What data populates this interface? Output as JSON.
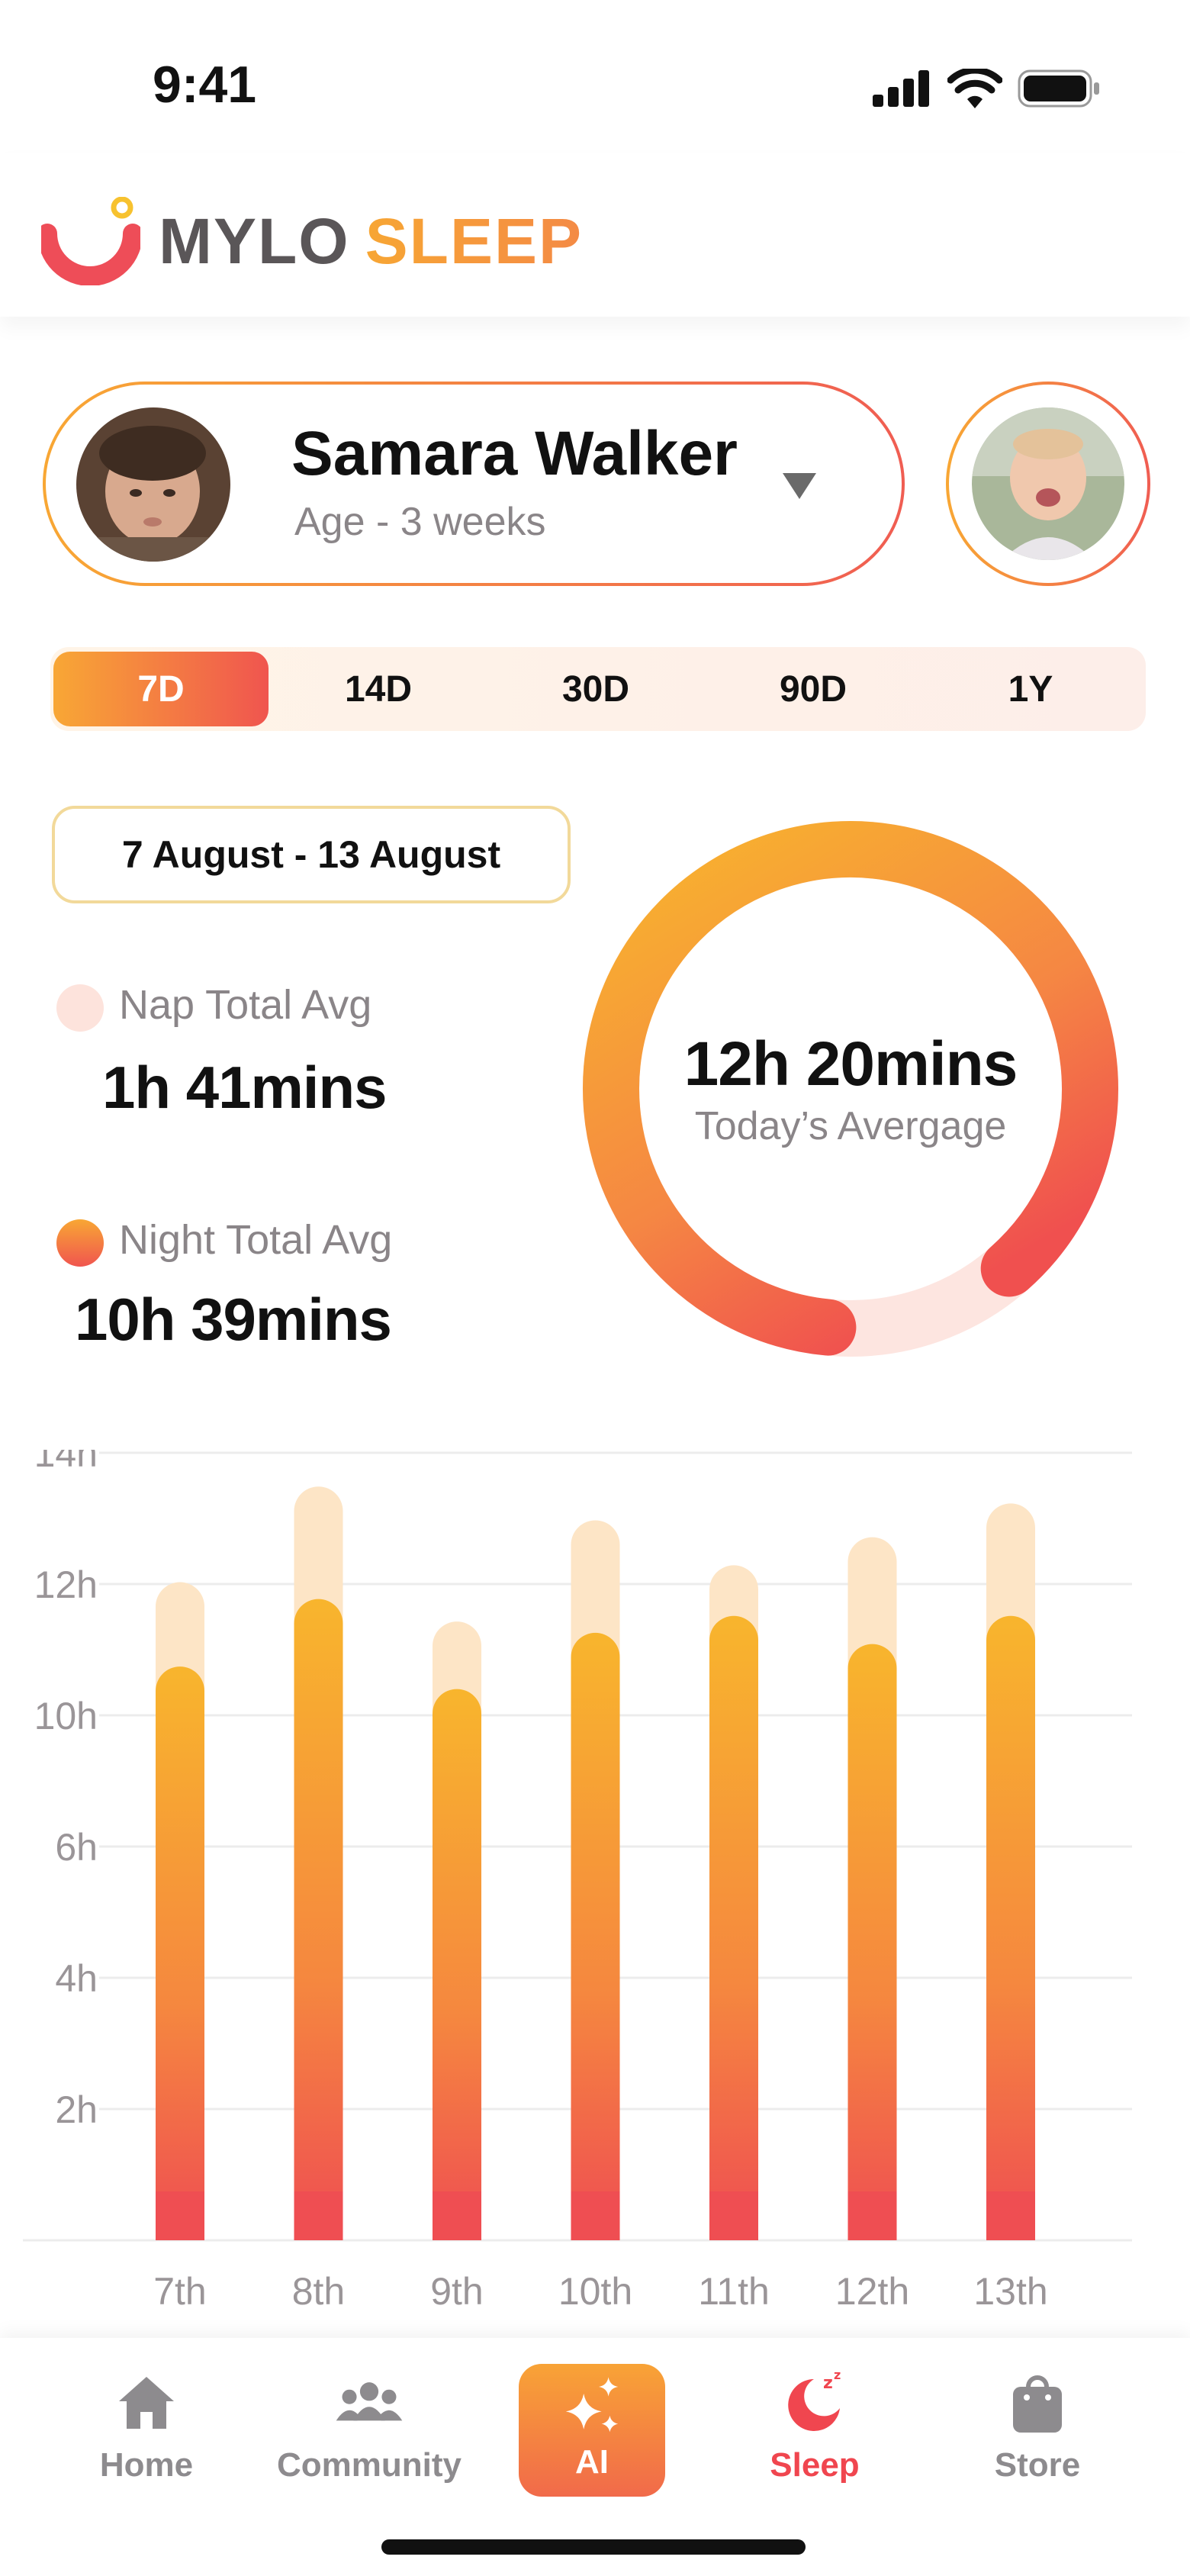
{
  "status_bar": {
    "time": "9:41"
  },
  "app": {
    "brand_primary": "MYLO",
    "brand_secondary": "SLEEP",
    "accent_orange": "#f8a734",
    "accent_red": "#f0554f"
  },
  "profile": {
    "name": "Samara Walker",
    "age": "Age - 3 weeks"
  },
  "range_tabs": [
    {
      "label": "7D",
      "active": true
    },
    {
      "label": "14D",
      "active": false
    },
    {
      "label": "30D",
      "active": false
    },
    {
      "label": "90D",
      "active": false
    },
    {
      "label": "1Y",
      "active": false
    }
  ],
  "date_range": "7 August - 13 August",
  "summary": {
    "nap_label": "Nap Total Avg",
    "nap_value": "1h 41mins",
    "night_label": "Night Total Avg",
    "night_value": "10h 39mins",
    "today_value": "12h 20mins",
    "today_caption": "Today’s Avergage",
    "today_progress": 0.87
  },
  "chart_data": {
    "type": "bar",
    "categories": [
      "7th",
      "8th",
      "9th",
      "10th",
      "11th",
      "12th",
      "13th"
    ],
    "y_tick_labels": [
      "2h",
      "4h",
      "6h",
      "10h",
      "12h",
      "14h"
    ],
    "ylim": [
      0,
      14
    ],
    "series": [
      {
        "values": [
          10.2,
          11.4,
          9.8,
          10.8,
          11.1,
          10.6,
          11.1
        ],
        "color": "#f8a734"
      },
      {
        "values": [
          1.5,
          2.0,
          1.2,
          2.0,
          0.9,
          1.9,
          2.0
        ],
        "color": "#fde5c6"
      }
    ]
  },
  "bottom_nav": [
    {
      "label": "Home",
      "icon": "home-icon",
      "active": false
    },
    {
      "label": "Community",
      "icon": "community-icon",
      "active": false
    },
    {
      "label": "AI",
      "icon": "sparkle-icon",
      "active": false
    },
    {
      "label": "Sleep",
      "icon": "sleep-moon-icon",
      "active": true
    },
    {
      "label": "Store",
      "icon": "shopping-bag-icon",
      "active": false
    }
  ]
}
